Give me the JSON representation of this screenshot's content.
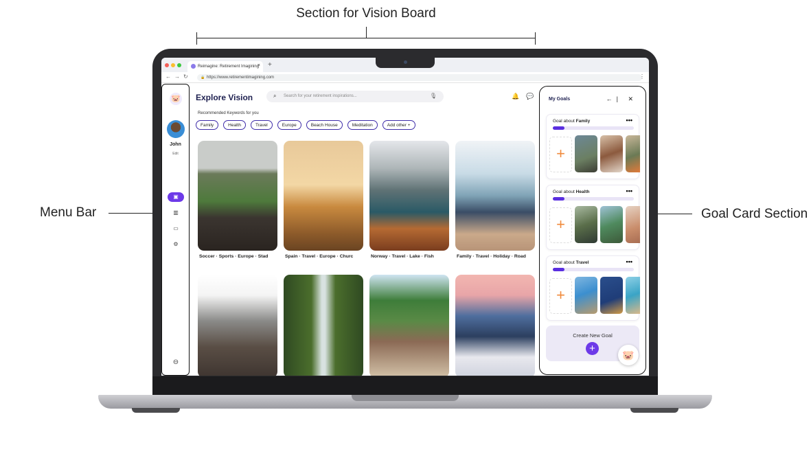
{
  "annotations": {
    "top": "Section for Vision Board",
    "left": "Menu Bar",
    "right": "Goal Card Section"
  },
  "browser": {
    "tab_title": "Reimagine: Retirement Imagining",
    "tab_close": "×",
    "new_tab": "+",
    "nav": "←→↻",
    "url": "https://www.retirementimagining.com",
    "lock": "🔒",
    "menu": "⋮"
  },
  "sidebar": {
    "logo": "🐷",
    "user_name": "John",
    "user_edit": "Edit",
    "icons": [
      "vision-board-icon",
      "chart-icon",
      "chat-icon",
      "settings-icon"
    ],
    "icon_glyphs": [
      "▣",
      "▥",
      "▭",
      "⚙"
    ],
    "logout_glyph": "⊖"
  },
  "main": {
    "title": "Explore Vision",
    "search_placeholder": "Search for your retirement inspirations...",
    "search_glyph": "⌕",
    "mic_glyph": "🎙",
    "bell_glyph": "🔔",
    "chat_glyph": "💬",
    "recommended_label": "Recommended Keywords for you",
    "chips": [
      "Family",
      "Health",
      "Travel",
      "Europe",
      "Beach House",
      "Meditation",
      "Add other +"
    ],
    "cards": [
      {
        "caption": "Soccer · Sports · Europe · Stad"
      },
      {
        "caption": "Spain · Travel · Europe · Churc"
      },
      {
        "caption": "Norway · Travel · Lake · Fish"
      },
      {
        "caption": "Family · Travel · Holiday · Road"
      },
      {
        "caption": ""
      },
      {
        "caption": ""
      },
      {
        "caption": ""
      },
      {
        "caption": ""
      }
    ]
  },
  "goals": {
    "header": "My Goals",
    "collapse_glyph": "←|",
    "close_glyph": "✕",
    "cards": [
      {
        "prefix": "Goal about ",
        "topic": "Family",
        "progress": 0.14
      },
      {
        "prefix": "Goal about ",
        "topic": "Health",
        "progress": 0.14
      },
      {
        "prefix": "Goal about ",
        "topic": "Travel",
        "progress": 0.14
      }
    ],
    "menu_glyph": "•••",
    "add_glyph": "+",
    "create_label": "Create New Goal",
    "create_glyph": "+",
    "pig_glyph": "🐷"
  }
}
